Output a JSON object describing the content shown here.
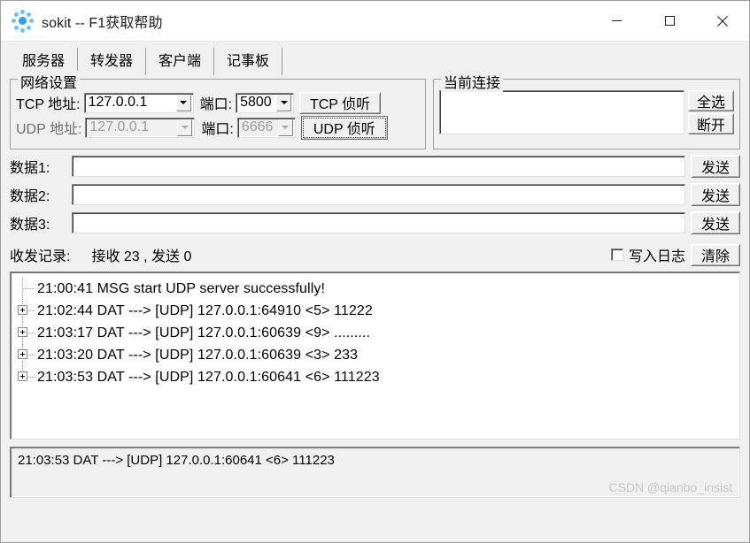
{
  "window": {
    "title": "sokit -- F1获取帮助",
    "icon": "sokit-dots-icon",
    "controls": {
      "minimize": "minimize-icon",
      "maximize": "maximize-icon",
      "close": "close-icon"
    }
  },
  "tabs": [
    {
      "label": "服务器",
      "selected": true
    },
    {
      "label": "转发器",
      "selected": false
    },
    {
      "label": "客户端",
      "selected": false
    },
    {
      "label": "记事板",
      "selected": false
    }
  ],
  "network_settings": {
    "title": "网络设置",
    "tcp": {
      "address_label": "TCP 地址:",
      "address_value": "127.0.0.1",
      "port_label": "端口:",
      "port_value": "5800",
      "listen_button": "TCP 侦听",
      "enabled": true
    },
    "udp": {
      "address_label": "UDP 地址:",
      "address_value": "127.0.0.1",
      "port_label": "端口:",
      "port_value": "6666",
      "listen_button": "UDP 侦听",
      "enabled": false
    }
  },
  "connections": {
    "title": "当前连接",
    "list_items": [],
    "select_all_button": "全选",
    "disconnect_button": "断开"
  },
  "data_rows": [
    {
      "label": "数据1:",
      "value": "",
      "placeholder": "",
      "send_button": "发送"
    },
    {
      "label": "数据2:",
      "value": "",
      "placeholder": "",
      "send_button": "发送"
    },
    {
      "label": "数据3:",
      "value": "",
      "placeholder": "",
      "send_button": "发送"
    }
  ],
  "status": {
    "label": "收发记录:",
    "counts": "接收 23 , 发送 0",
    "received": 23,
    "sent": 0,
    "write_log_label": "写入日志",
    "write_log_checked": false,
    "clear_button": "清除"
  },
  "log": {
    "entries": [
      {
        "text": "21:00:41 MSG start UDP server successfully!",
        "expandable": false
      },
      {
        "text": "21:02:44 DAT ---> [UDP] 127.0.0.1:64910 <5> 11222",
        "expandable": true
      },
      {
        "text": "21:03:17 DAT ---> [UDP] 127.0.0.1:60639 <9> .........",
        "expandable": true
      },
      {
        "text": "21:03:20 DAT ---> [UDP] 127.0.0.1:60639 <3> 233",
        "expandable": true
      },
      {
        "text": "21:03:53 DAT ---> [UDP] 127.0.0.1:60641 <6> 111223",
        "expandable": true
      }
    ]
  },
  "detail": {
    "text": "21:03:53 DAT ---> [UDP] 127.0.0.1:60641 <6> 111223",
    "watermark": "CSDN @qianbo_insist"
  },
  "colors": {
    "window_bg": "#f0f0f0",
    "titlebar_bg": "#ffffff",
    "field_bg": "#ffffff",
    "disabled_text": "#9a9a9a",
    "icon_blue": "#6fc3f0",
    "watermark": "#c8c8c8"
  }
}
